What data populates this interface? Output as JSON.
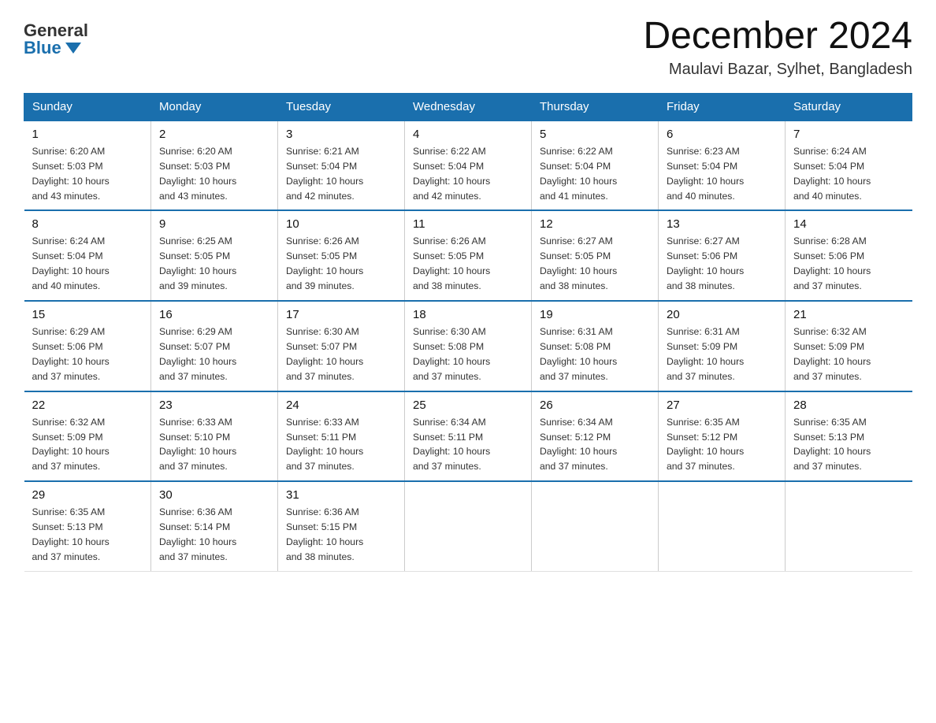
{
  "header": {
    "logo_general": "General",
    "logo_blue": "Blue",
    "month_title": "December 2024",
    "subtitle": "Maulavi Bazar, Sylhet, Bangladesh"
  },
  "days_of_week": [
    "Sunday",
    "Monday",
    "Tuesday",
    "Wednesday",
    "Thursday",
    "Friday",
    "Saturday"
  ],
  "weeks": [
    [
      {
        "day": "1",
        "sunrise": "6:20 AM",
        "sunset": "5:03 PM",
        "daylight": "10 hours and 43 minutes."
      },
      {
        "day": "2",
        "sunrise": "6:20 AM",
        "sunset": "5:03 PM",
        "daylight": "10 hours and 43 minutes."
      },
      {
        "day": "3",
        "sunrise": "6:21 AM",
        "sunset": "5:04 PM",
        "daylight": "10 hours and 42 minutes."
      },
      {
        "day": "4",
        "sunrise": "6:22 AM",
        "sunset": "5:04 PM",
        "daylight": "10 hours and 42 minutes."
      },
      {
        "day": "5",
        "sunrise": "6:22 AM",
        "sunset": "5:04 PM",
        "daylight": "10 hours and 41 minutes."
      },
      {
        "day": "6",
        "sunrise": "6:23 AM",
        "sunset": "5:04 PM",
        "daylight": "10 hours and 40 minutes."
      },
      {
        "day": "7",
        "sunrise": "6:24 AM",
        "sunset": "5:04 PM",
        "daylight": "10 hours and 40 minutes."
      }
    ],
    [
      {
        "day": "8",
        "sunrise": "6:24 AM",
        "sunset": "5:04 PM",
        "daylight": "10 hours and 40 minutes."
      },
      {
        "day": "9",
        "sunrise": "6:25 AM",
        "sunset": "5:05 PM",
        "daylight": "10 hours and 39 minutes."
      },
      {
        "day": "10",
        "sunrise": "6:26 AM",
        "sunset": "5:05 PM",
        "daylight": "10 hours and 39 minutes."
      },
      {
        "day": "11",
        "sunrise": "6:26 AM",
        "sunset": "5:05 PM",
        "daylight": "10 hours and 38 minutes."
      },
      {
        "day": "12",
        "sunrise": "6:27 AM",
        "sunset": "5:05 PM",
        "daylight": "10 hours and 38 minutes."
      },
      {
        "day": "13",
        "sunrise": "6:27 AM",
        "sunset": "5:06 PM",
        "daylight": "10 hours and 38 minutes."
      },
      {
        "day": "14",
        "sunrise": "6:28 AM",
        "sunset": "5:06 PM",
        "daylight": "10 hours and 37 minutes."
      }
    ],
    [
      {
        "day": "15",
        "sunrise": "6:29 AM",
        "sunset": "5:06 PM",
        "daylight": "10 hours and 37 minutes."
      },
      {
        "day": "16",
        "sunrise": "6:29 AM",
        "sunset": "5:07 PM",
        "daylight": "10 hours and 37 minutes."
      },
      {
        "day": "17",
        "sunrise": "6:30 AM",
        "sunset": "5:07 PM",
        "daylight": "10 hours and 37 minutes."
      },
      {
        "day": "18",
        "sunrise": "6:30 AM",
        "sunset": "5:08 PM",
        "daylight": "10 hours and 37 minutes."
      },
      {
        "day": "19",
        "sunrise": "6:31 AM",
        "sunset": "5:08 PM",
        "daylight": "10 hours and 37 minutes."
      },
      {
        "day": "20",
        "sunrise": "6:31 AM",
        "sunset": "5:09 PM",
        "daylight": "10 hours and 37 minutes."
      },
      {
        "day": "21",
        "sunrise": "6:32 AM",
        "sunset": "5:09 PM",
        "daylight": "10 hours and 37 minutes."
      }
    ],
    [
      {
        "day": "22",
        "sunrise": "6:32 AM",
        "sunset": "5:09 PM",
        "daylight": "10 hours and 37 minutes."
      },
      {
        "day": "23",
        "sunrise": "6:33 AM",
        "sunset": "5:10 PM",
        "daylight": "10 hours and 37 minutes."
      },
      {
        "day": "24",
        "sunrise": "6:33 AM",
        "sunset": "5:11 PM",
        "daylight": "10 hours and 37 minutes."
      },
      {
        "day": "25",
        "sunrise": "6:34 AM",
        "sunset": "5:11 PM",
        "daylight": "10 hours and 37 minutes."
      },
      {
        "day": "26",
        "sunrise": "6:34 AM",
        "sunset": "5:12 PM",
        "daylight": "10 hours and 37 minutes."
      },
      {
        "day": "27",
        "sunrise": "6:35 AM",
        "sunset": "5:12 PM",
        "daylight": "10 hours and 37 minutes."
      },
      {
        "day": "28",
        "sunrise": "6:35 AM",
        "sunset": "5:13 PM",
        "daylight": "10 hours and 37 minutes."
      }
    ],
    [
      {
        "day": "29",
        "sunrise": "6:35 AM",
        "sunset": "5:13 PM",
        "daylight": "10 hours and 37 minutes."
      },
      {
        "day": "30",
        "sunrise": "6:36 AM",
        "sunset": "5:14 PM",
        "daylight": "10 hours and 37 minutes."
      },
      {
        "day": "31",
        "sunrise": "6:36 AM",
        "sunset": "5:15 PM",
        "daylight": "10 hours and 38 minutes."
      },
      null,
      null,
      null,
      null
    ]
  ],
  "labels": {
    "sunrise_prefix": "Sunrise: ",
    "sunset_prefix": "Sunset: ",
    "daylight_prefix": "Daylight: "
  }
}
